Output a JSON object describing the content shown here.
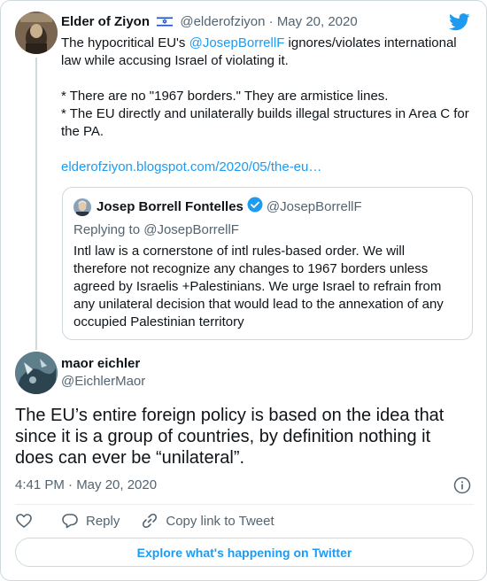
{
  "parent_tweet": {
    "name": "Elder of Ziyon",
    "handle": "@elderofziyon",
    "separator": "·",
    "date": "May 20, 2020",
    "text_lines": [
      [
        "The hypocritical EU's ",
        "@JosepBorrellF",
        " ignores/violates international law while accusing Israel of violating it."
      ],
      "* There are  no \"1967 borders.\" They are armistice lines.",
      "* The EU directly and unilaterally builds illegal structures in Area C for the PA.",
      "elderofziyon.blogspot.com/2020/05/the-eu…"
    ]
  },
  "quoted_tweet": {
    "name": "Josep Borrell Fontelles",
    "handle": "@JosepBorrellF",
    "replying_to": "Replying to @JosepBorrellF",
    "text": "Intl law is a cornerstone of intl rules-based order. We will therefore not recognize any changes to 1967 borders unless agreed by Israelis +Palestinians. We urge Israel to refrain from any unilateral decision that would lead to the annexation of any occupied Palestinian territory"
  },
  "main_tweet": {
    "name": "maor eichler",
    "handle": "@EichlerMaor",
    "text": "The EU’s entire foreign policy is based on the idea that since it is a group of countries, by definition nothing it does can ever be “unilateral”.",
    "timestamp": "4:41 PM · May 20, 2020"
  },
  "actions": {
    "reply": "Reply",
    "copy_link": "Copy link to Tweet"
  },
  "explore_label": "Explore what's happening on Twitter",
  "colors": {
    "accent": "#1d9bf0",
    "text": "#0f1419",
    "muted": "#536471",
    "border": "#cfd9de"
  }
}
